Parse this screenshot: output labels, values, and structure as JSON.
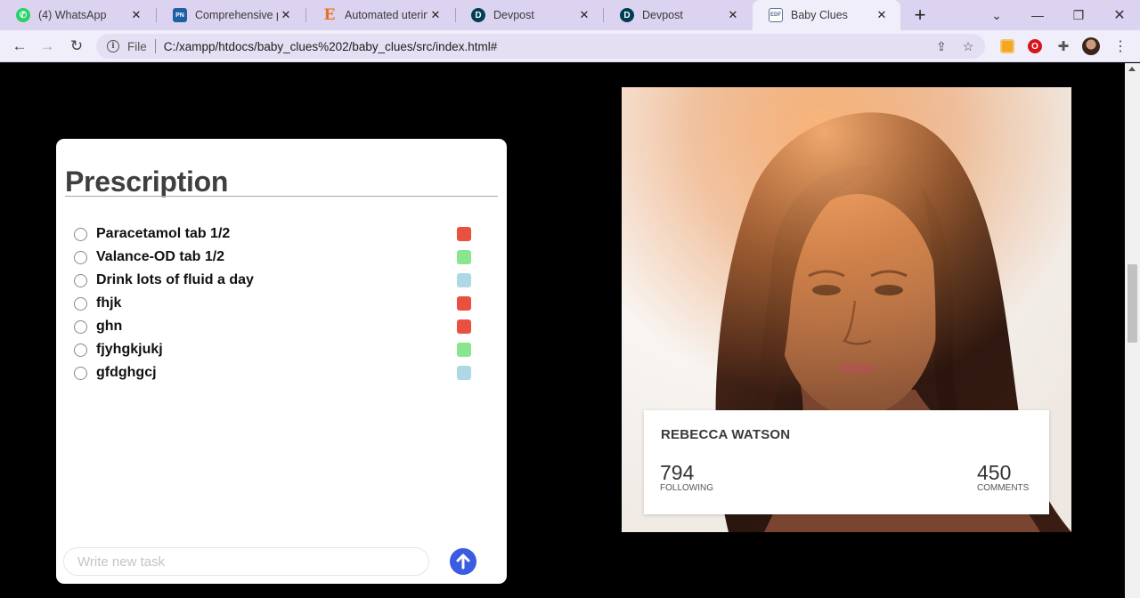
{
  "browser": {
    "tabs": [
      {
        "title": "(4) WhatsApp",
        "icon": "whatsapp-icon",
        "color": "#25d366"
      },
      {
        "title": "Comprehensive pre",
        "icon": "pnas-icon",
        "color": "#1f5fa3"
      },
      {
        "title": "Automated uterine",
        "icon": "elsevier-icon",
        "color": "#e9711c"
      },
      {
        "title": "Devpost",
        "icon": "devpost-icon",
        "color": "#003e54"
      },
      {
        "title": "Devpost",
        "icon": "devpost-icon",
        "color": "#003e54"
      },
      {
        "title": "Baby Clues",
        "icon": "pdf-file-icon",
        "color": "#5d6d8e"
      }
    ],
    "omnibox": {
      "scheme": "File",
      "url": "C:/xampp/htdocs/baby_clues%202/baby_clues/src/index.html#"
    }
  },
  "prescription": {
    "title": "Prescription",
    "items": [
      {
        "text": "Paracetamol tab 1/2",
        "color": "#e8503f"
      },
      {
        "text": "Valance-OD tab 1/2",
        "color": "#8ae68e"
      },
      {
        "text": "Drink lots of fluid a day",
        "color": "#add8e6"
      },
      {
        "text": "fhjk",
        "color": "#e8503f"
      },
      {
        "text": "ghn",
        "color": "#e8503f"
      },
      {
        "text": "fjyhgkjukj",
        "color": "#8ae68e"
      },
      {
        "text": "gfdghgcj",
        "color": "#add8e6"
      }
    ],
    "input_placeholder": "Write new task"
  },
  "profile": {
    "name": "REBECCA WATSON",
    "following_value": "794",
    "following_label": "FOLLOWING",
    "comments_value": "450",
    "comments_label": "COMMENTS"
  }
}
